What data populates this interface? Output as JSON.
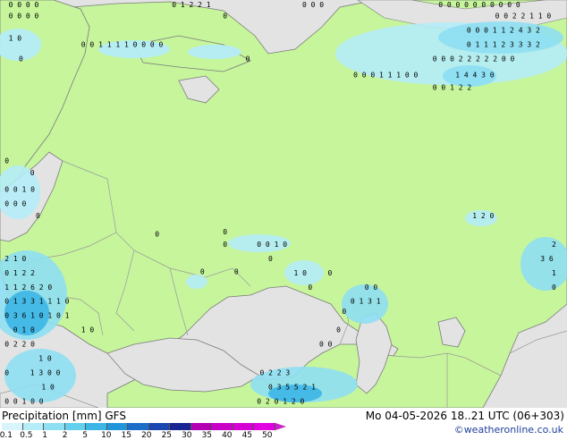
{
  "title": "Precipitation [mm] GFS",
  "valid_time": "Mo 04-05-2026 18..21 UTC (06+303)",
  "credit": "©weatheronline.co.uk",
  "colors": {
    "land": "#c6f59c",
    "sea": "#e3e3e3",
    "border": "#9a9a9a",
    "coast": "#7a7a7a"
  },
  "legend": {
    "labels": [
      "0.1",
      "0.5",
      "1",
      "2",
      "5",
      "10",
      "15",
      "20",
      "25",
      "30",
      "35",
      "40",
      "45",
      "50"
    ],
    "colors": [
      "#d8f5fb",
      "#b4ecf7",
      "#8edff2",
      "#63d0ed",
      "#3cb6e6",
      "#1f95dc",
      "#1b6dc8",
      "#1946b0",
      "#172491",
      "#b300b3",
      "#c800c8",
      "#d400d4",
      "#e000e0",
      "#cc22cc"
    ]
  },
  "annotations": [
    {
      "lon": 0.012,
      "lat": 0.013,
      "text": "0 0 0 0"
    },
    {
      "lon": 0.3,
      "lat": 0.013,
      "text": "0 1 2 2 1"
    },
    {
      "lon": 0.53,
      "lat": 0.013,
      "text": "0 0 0"
    },
    {
      "lon": 0.77,
      "lat": 0.013,
      "text": "0 0 0 0 0 0 0 0 0 0"
    },
    {
      "lon": 0.012,
      "lat": 0.045,
      "text": "0 0 0 0"
    },
    {
      "lon": 0.39,
      "lat": 0.045,
      "text": "0"
    },
    {
      "lon": 0.87,
      "lat": 0.045,
      "text": "0 0 2 2 1 1 0"
    },
    {
      "lon": 0.012,
      "lat": 0.1,
      "text": "1 0"
    },
    {
      "lon": 0.14,
      "lat": 0.115,
      "text": "0 0 1 1 1 1 0 0 0 0"
    },
    {
      "lon": 0.82,
      "lat": 0.08,
      "text": "0 0 0 1 1 2 4 3 2"
    },
    {
      "lon": 0.82,
      "lat": 0.115,
      "text": "0 1 1 1 2 3 3 3 2"
    },
    {
      "lon": 0.03,
      "lat": 0.15,
      "text": "0"
    },
    {
      "lon": 0.43,
      "lat": 0.15,
      "text": "0"
    },
    {
      "lon": 0.76,
      "lat": 0.15,
      "text": "0 0 0 2 2 2 2 2 0 0"
    },
    {
      "lon": 0.62,
      "lat": 0.19,
      "text": "0 0 0 1 1 1 0 0"
    },
    {
      "lon": 0.8,
      "lat": 0.19,
      "text": "1 4 4 3 0"
    },
    {
      "lon": 0.76,
      "lat": 0.22,
      "text": "0 0 1 2 2"
    },
    {
      "lon": 0.005,
      "lat": 0.4,
      "text": "0"
    },
    {
      "lon": 0.05,
      "lat": 0.43,
      "text": "0"
    },
    {
      "lon": 0.005,
      "lat": 0.47,
      "text": "0 0 1 0"
    },
    {
      "lon": 0.005,
      "lat": 0.505,
      "text": "0 0 0"
    },
    {
      "lon": 0.06,
      "lat": 0.535,
      "text": "0"
    },
    {
      "lon": 0.83,
      "lat": 0.535,
      "text": "1 2 0"
    },
    {
      "lon": 0.27,
      "lat": 0.58,
      "text": "0"
    },
    {
      "lon": 0.39,
      "lat": 0.575,
      "text": "0"
    },
    {
      "lon": 0.39,
      "lat": 0.605,
      "text": "0"
    },
    {
      "lon": 0.45,
      "lat": 0.605,
      "text": "0 0 1 0"
    },
    {
      "lon": 0.97,
      "lat": 0.605,
      "text": "2"
    },
    {
      "lon": 0.005,
      "lat": 0.64,
      "text": "2 1 0"
    },
    {
      "lon": 0.47,
      "lat": 0.64,
      "text": "0"
    },
    {
      "lon": 0.95,
      "lat": 0.64,
      "text": "3 6"
    },
    {
      "lon": 0.005,
      "lat": 0.675,
      "text": "0 1 2 2"
    },
    {
      "lon": 0.35,
      "lat": 0.672,
      "text": "0"
    },
    {
      "lon": 0.41,
      "lat": 0.672,
      "text": "0"
    },
    {
      "lon": 0.515,
      "lat": 0.675,
      "text": "1 0"
    },
    {
      "lon": 0.575,
      "lat": 0.675,
      "text": "0"
    },
    {
      "lon": 0.97,
      "lat": 0.675,
      "text": "1"
    },
    {
      "lon": 0.005,
      "lat": 0.71,
      "text": "1 1 2 6 2 0"
    },
    {
      "lon": 0.54,
      "lat": 0.71,
      "text": "0"
    },
    {
      "lon": 0.64,
      "lat": 0.71,
      "text": "0 0"
    },
    {
      "lon": 0.97,
      "lat": 0.71,
      "text": "0"
    },
    {
      "lon": 0.005,
      "lat": 0.745,
      "text": "0 1 3 3 1 1 1 0"
    },
    {
      "lon": 0.615,
      "lat": 0.745,
      "text": "0 1 3 1"
    },
    {
      "lon": 0.005,
      "lat": 0.78,
      "text": "0 3 6 1 0 1 0 1"
    },
    {
      "lon": 0.6,
      "lat": 0.77,
      "text": "0"
    },
    {
      "lon": 0.02,
      "lat": 0.815,
      "text": "0 1 0"
    },
    {
      "lon": 0.14,
      "lat": 0.815,
      "text": "1 0"
    },
    {
      "lon": 0.59,
      "lat": 0.815,
      "text": "0"
    },
    {
      "lon": 0.005,
      "lat": 0.85,
      "text": "0 2 2 0"
    },
    {
      "lon": 0.56,
      "lat": 0.85,
      "text": "0 0"
    },
    {
      "lon": 0.065,
      "lat": 0.885,
      "text": "1 0"
    },
    {
      "lon": 0.005,
      "lat": 0.92,
      "text": "0"
    },
    {
      "lon": 0.05,
      "lat": 0.92,
      "text": "1 3 0 0"
    },
    {
      "lon": 0.455,
      "lat": 0.92,
      "text": "0 2 2 3"
    },
    {
      "lon": 0.07,
      "lat": 0.955,
      "text": "1 0"
    },
    {
      "lon": 0.47,
      "lat": 0.955,
      "text": "0 3 5 5 2 1"
    },
    {
      "lon": 0.005,
      "lat": 0.99,
      "text": "0 0 1 0 0"
    },
    {
      "lon": 0.45,
      "lat": 0.99,
      "text": "0 2 0 1 2 0"
    }
  ]
}
